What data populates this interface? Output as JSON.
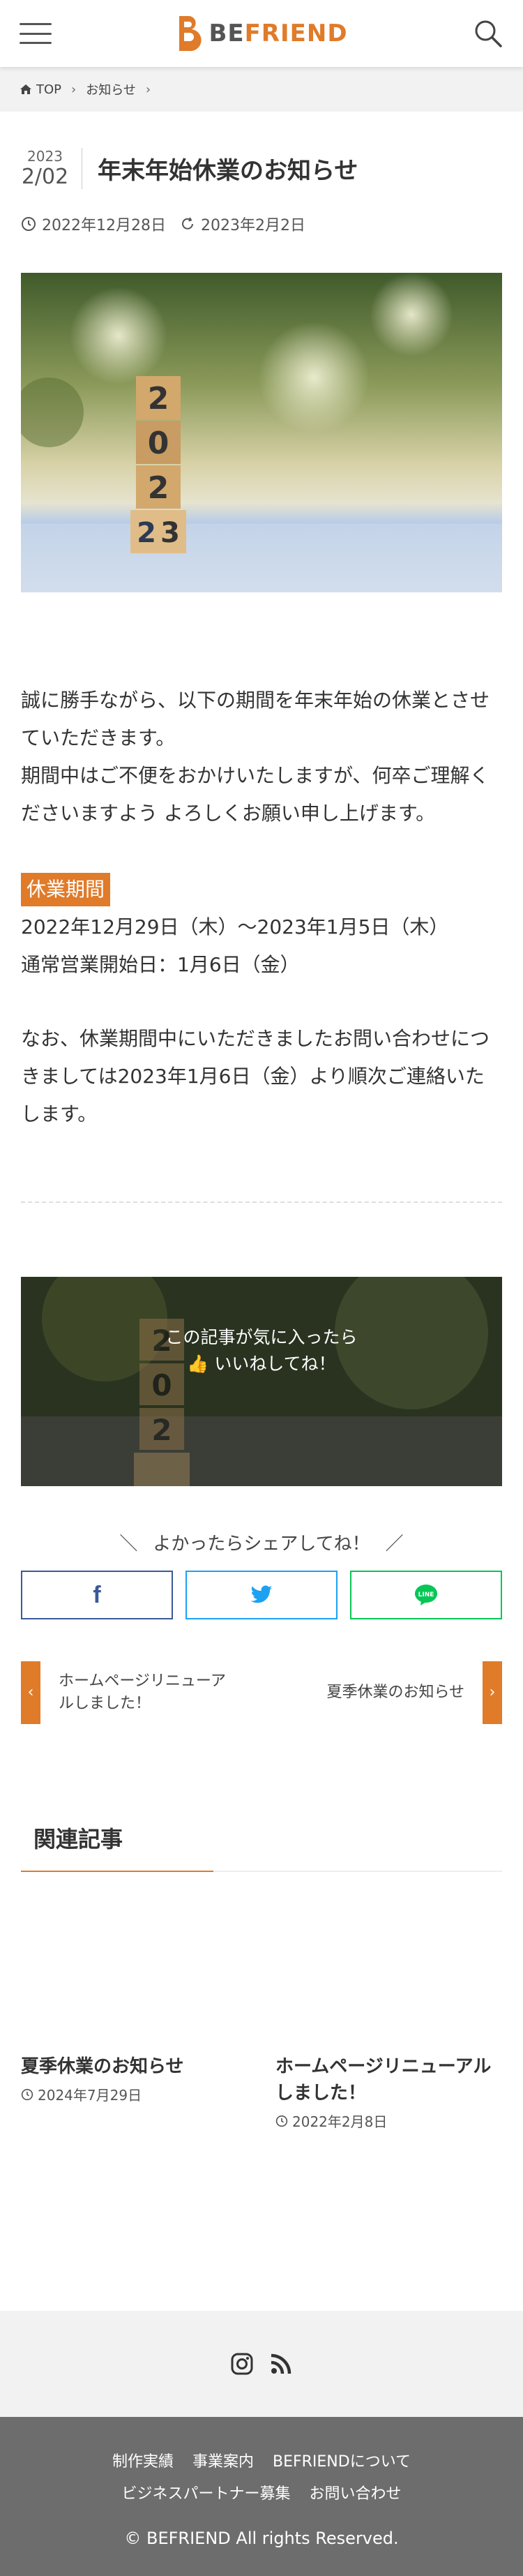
{
  "header": {
    "logo_text_main": "BE",
    "logo_text_accent": "FRIEND"
  },
  "breadcrumb": {
    "items": [
      "TOP",
      "お知らせ"
    ]
  },
  "article": {
    "date_year": "2023",
    "date_md": "2/02",
    "title": "年末年始休業のお知らせ",
    "published": "2022年12月28日",
    "updated": "2023年2月2日",
    "paragraphs": [
      "誠に勝手ながら、以下の期間を年末年始の休業とさせていただきます。",
      "期間中はご不便をおかけいたしますが、何卒ご理解くださいますよう よろしくお願い申し上げます。"
    ],
    "tag": "休業期間",
    "period": "2022年12月29日（木）〜2023年1月5日（木）",
    "resume": "通常営業開始日：1月6日（金）",
    "closing": "なお、休業期間中にいただきましたお問い合わせにつきましては2023年1月6日（金）より順次ご連絡いたします。"
  },
  "like": {
    "line1": "この記事が気に入ったら",
    "line2": "いいねしてね！"
  },
  "share": {
    "title": "よかったらシェアしてね！",
    "facebook_icon": "f",
    "line_icon": "LINE"
  },
  "pager": {
    "prev": "ホームページリニューアルしました！",
    "next": "夏季休業のお知らせ"
  },
  "related": {
    "heading": "関連記事",
    "items": [
      {
        "title": "夏季休業のお知らせ",
        "date": "2024年7月29日"
      },
      {
        "title": "ホームページリニューアルしました！",
        "date": "2022年2月8日"
      }
    ]
  },
  "footer": {
    "links_row1": [
      "制作実績",
      "事業案内",
      "BEFRIENDについて"
    ],
    "links_row2": [
      "ビジネスパートナー募集",
      "お問い合わせ"
    ],
    "copyright": "© BEFRIEND All rights Reserved."
  },
  "colors": {
    "accent": "#e07b2a",
    "facebook": "#3b5998",
    "twitter": "#1da1f2",
    "line": "#06c755",
    "footer_bg": "#6d6d6d"
  }
}
